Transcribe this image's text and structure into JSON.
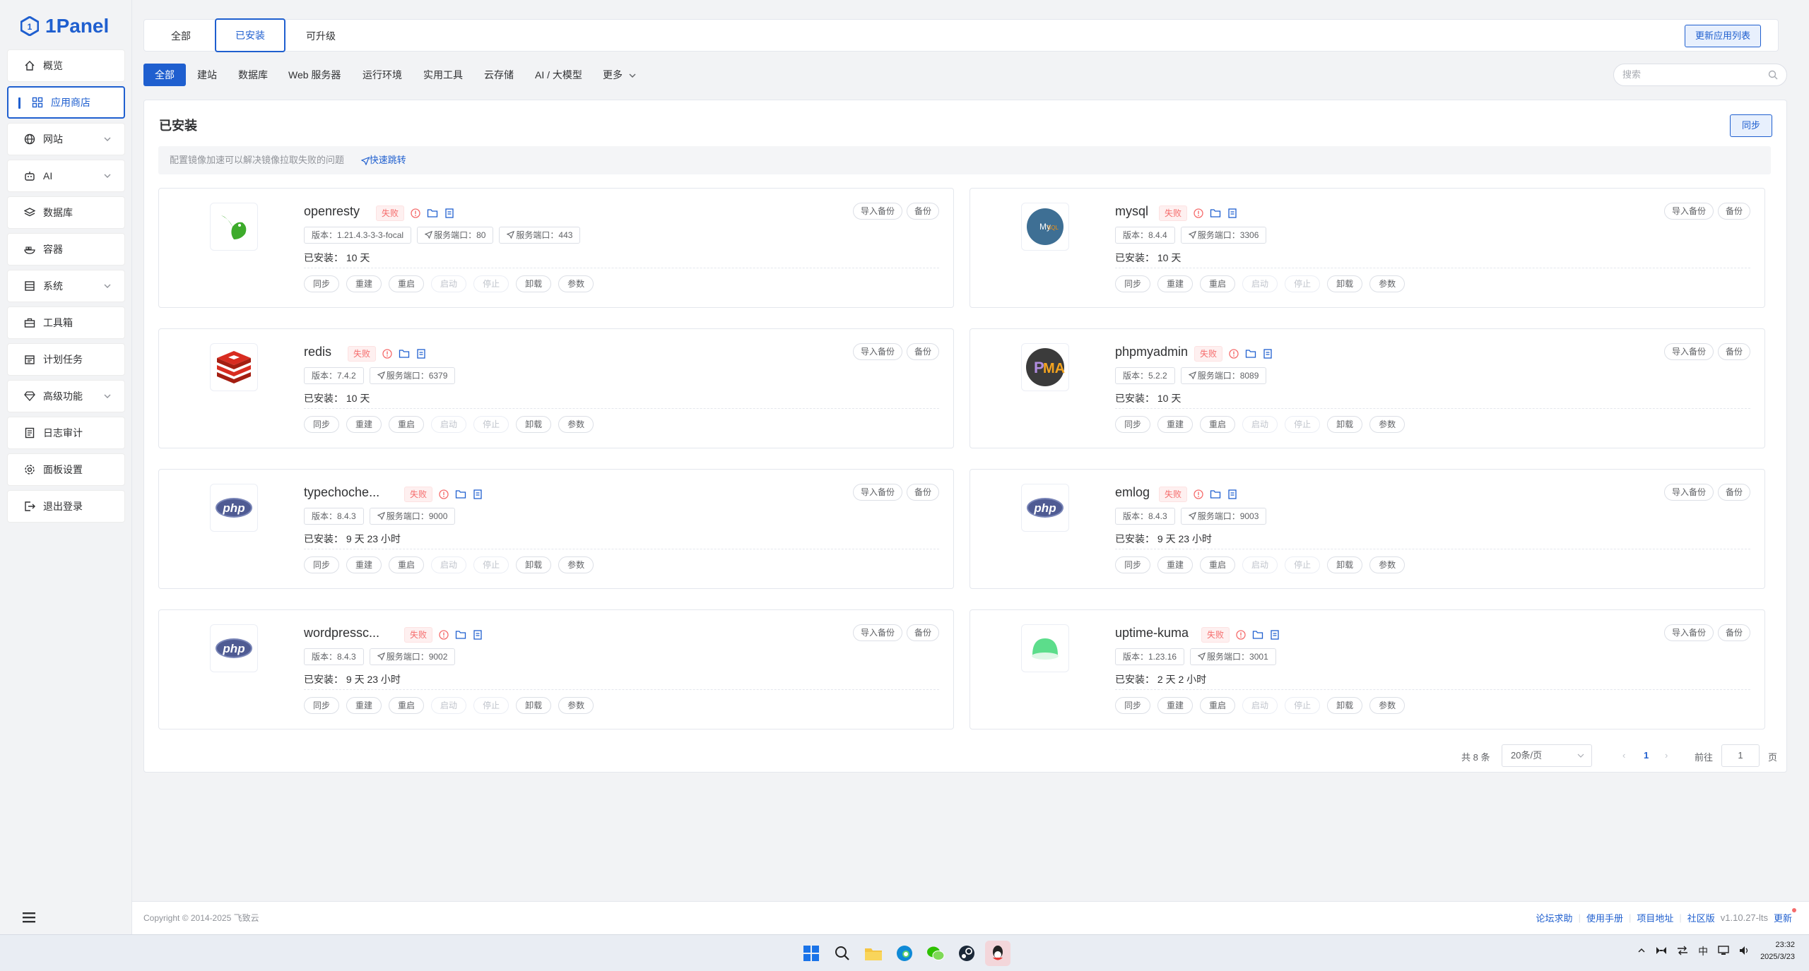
{
  "app": {
    "logo_text": "1Panel"
  },
  "sidebar": {
    "items": [
      {
        "label": "概览",
        "icon": "home-icon",
        "chevron": false
      },
      {
        "label": "应用商店",
        "icon": "apps-icon",
        "chevron": false,
        "active": true
      },
      {
        "label": "网站",
        "icon": "globe-icon",
        "chevron": true
      },
      {
        "label": "AI",
        "icon": "robot-icon",
        "chevron": true
      },
      {
        "label": "数据库",
        "icon": "layers-icon",
        "chevron": false
      },
      {
        "label": "容器",
        "icon": "container-icon",
        "chevron": false
      },
      {
        "label": "系统",
        "icon": "server-icon",
        "chevron": true
      },
      {
        "label": "工具箱",
        "icon": "toolbox-icon",
        "chevron": false
      },
      {
        "label": "计划任务",
        "icon": "calendar-icon",
        "chevron": false
      },
      {
        "label": "高级功能",
        "icon": "diamond-icon",
        "chevron": true
      },
      {
        "label": "日志审计",
        "icon": "log-icon",
        "chevron": false
      },
      {
        "label": "面板设置",
        "icon": "gear-icon",
        "chevron": false
      },
      {
        "label": "退出登录",
        "icon": "logout-icon",
        "chevron": false
      }
    ]
  },
  "top_tabs": [
    {
      "label": "全部"
    },
    {
      "label": "已安装",
      "active": true
    },
    {
      "label": "可升级"
    }
  ],
  "update_list_label": "更新应用列表",
  "categories": [
    "全部",
    "建站",
    "数据库",
    "Web 服务器",
    "运行环境",
    "实用工具",
    "云存储",
    "AI / 大模型",
    "更多"
  ],
  "search": {
    "placeholder": "搜索"
  },
  "panel": {
    "title": "已安装",
    "sync_label": "同步",
    "notice_text": "配置镜像加速可以解决镜像拉取失败的问题",
    "notice_link": "快速跳转"
  },
  "card_labels": {
    "status": "失败",
    "import_backup": "导入备份",
    "backup": "备份",
    "actions": [
      "同步",
      "重建",
      "重启",
      "启动",
      "停止",
      "卸载",
      "参数"
    ]
  },
  "apps": [
    {
      "name": "openresty",
      "version": "版本：1.21.4.3-3-3-focal",
      "ports": [
        "服务端口：80",
        "服务端口：443"
      ],
      "installed": "已安装：  10 天",
      "icon": "openresty-logo-icon"
    },
    {
      "name": "mysql",
      "version": "版本：8.4.4",
      "ports": [
        "服务端口：3306"
      ],
      "installed": "已安装：  10 天",
      "icon": "mysql-logo-icon"
    },
    {
      "name": "redis",
      "version": "版本：7.4.2",
      "ports": [
        "服务端口：6379"
      ],
      "installed": "已安装：  10 天",
      "icon": "redis-logo-icon"
    },
    {
      "name": "phpmyadmin",
      "version": "版本：5.2.2",
      "ports": [
        "服务端口：8089"
      ],
      "installed": "已安装：  10 天",
      "icon": "phpmyadmin-logo-icon"
    },
    {
      "name": "typechoche...",
      "version": "版本：8.4.3",
      "ports": [
        "服务端口：9000"
      ],
      "installed": "已安装：  9 天 23 小时",
      "icon": "php-logo-icon"
    },
    {
      "name": "emlog",
      "version": "版本：8.4.3",
      "ports": [
        "服务端口：9003"
      ],
      "installed": "已安装：  9 天 23 小时",
      "icon": "php-logo-icon"
    },
    {
      "name": "wordpressc...",
      "version": "版本：8.4.3",
      "ports": [
        "服务端口：9002"
      ],
      "installed": "已安装：  9 天 23 小时",
      "icon": "php-logo-icon"
    },
    {
      "name": "uptime-kuma",
      "version": "版本：1.23.16",
      "ports": [
        "服务端口：3001"
      ],
      "installed": "已安装：  2 天 2 小时",
      "icon": "uptime-kuma-logo-icon"
    }
  ],
  "pager": {
    "total": "共 8 条",
    "page_size": "20条/页",
    "current_page": "1",
    "goto_label": "前往",
    "goto_value": "1",
    "page_suffix": "页"
  },
  "footer": {
    "copyright": "Copyright © 2014-2025 飞致云",
    "links": [
      "论坛求助",
      "使用手册",
      "项目地址"
    ],
    "edition": "社区版",
    "version": "v1.10.27-lts",
    "update": "更新"
  },
  "taskbar": {
    "clock_time": "23:32",
    "clock_date": "2025/3/23",
    "ime": "中"
  },
  "colors": {
    "accent": "#1f5fcf",
    "danger": "#f56c6c"
  }
}
